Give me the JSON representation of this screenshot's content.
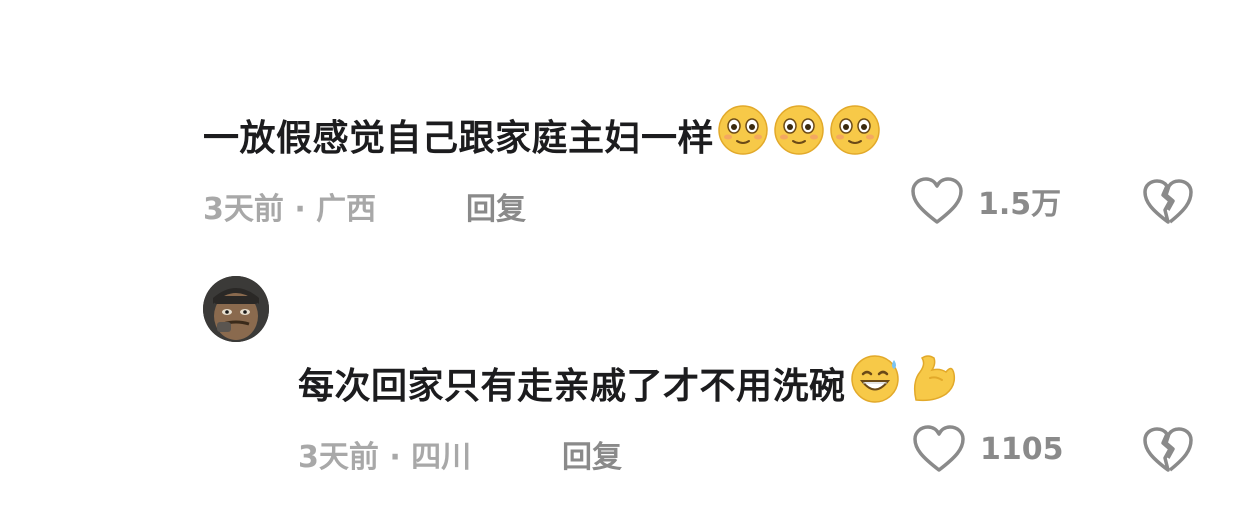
{
  "comments": [
    {
      "text": "一放假感觉自己跟家庭主妇一样",
      "emojis": [
        "smile-flushed-icon",
        "smile-flushed-icon",
        "smile-flushed-icon"
      ],
      "meta": "3天前 · 广西",
      "reply_label": "回复",
      "like_count": "1.5万"
    },
    {
      "text": "每次回家只有走亲戚了才不用洗碗",
      "emojis": [
        "grin-sweat-icon",
        "flexed-bicep-icon"
      ],
      "meta": "3天前 · 四川",
      "reply_label": "回复",
      "like_count": "1105"
    }
  ],
  "colors": {
    "text": "#1c1c1e",
    "meta": "#a8a8a8",
    "icon": "#8a8a8a",
    "emoji_yellow": "#f7c948"
  }
}
